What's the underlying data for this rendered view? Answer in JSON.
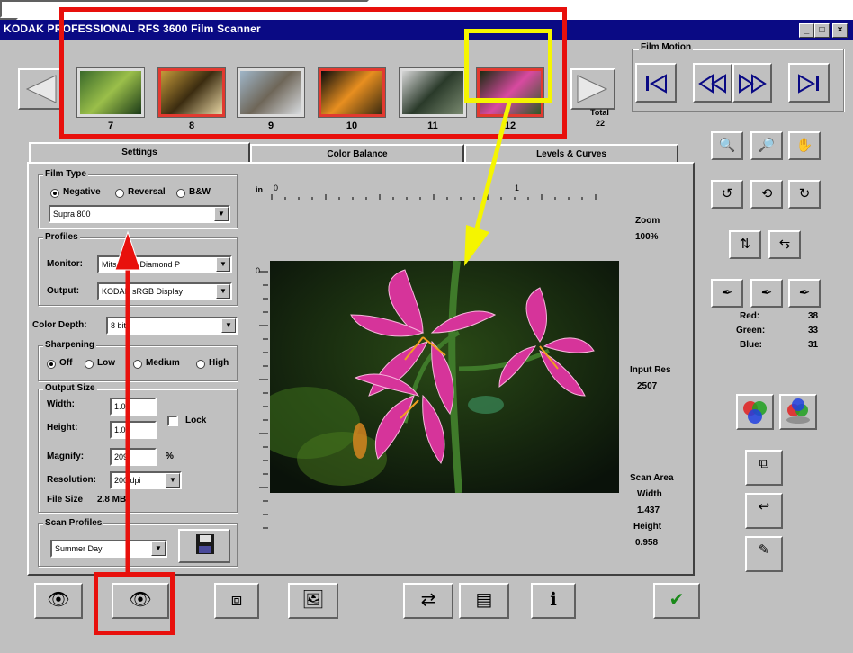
{
  "window": {
    "title": "KODAK PROFESSIONAL RFS 3600 Film Scanner",
    "minimize": "_",
    "maximize": "□",
    "close": "×"
  },
  "filmstrip": {
    "frames": [
      {
        "label": "7",
        "selected": false,
        "colors": [
          "#3a6a2a",
          "#9bbf4a",
          "#1b3a18"
        ]
      },
      {
        "label": "8",
        "selected": true,
        "colors": [
          "#c69a3a",
          "#3b2c10",
          "#e8d6a4"
        ]
      },
      {
        "label": "9",
        "selected": false,
        "colors": [
          "#9fb5c8",
          "#6e6658",
          "#d9dce0"
        ]
      },
      {
        "label": "10",
        "selected": true,
        "colors": [
          "#0b0b0b",
          "#e88f20",
          "#3a2a10"
        ]
      },
      {
        "label": "11",
        "selected": false,
        "colors": [
          "#d6d6d6",
          "#2a3a2a",
          "#7a8a70"
        ]
      },
      {
        "label": "12",
        "selected": true,
        "colors": [
          "#1a2a10",
          "#d84aa0",
          "#2f5a26"
        ]
      }
    ],
    "total_label": "Total",
    "total_value": "22"
  },
  "film_motion": {
    "label": "Film Motion"
  },
  "tabs": [
    {
      "label": "Settings",
      "active": true
    },
    {
      "label": "Color Balance",
      "active": false
    },
    {
      "label": "Levels & Curves",
      "active": false
    }
  ],
  "film_type": {
    "group_label": "Film Type",
    "options": [
      "Negative",
      "Reversal",
      "B&W"
    ],
    "selected": "Negative",
    "film": "Supra 800"
  },
  "profiles": {
    "group_label": "Profiles",
    "monitor_label": "Monitor:",
    "monitor_value": "Mitsubishi Diamond P",
    "output_label": "Output:",
    "output_value": "KODAK sRGB Display"
  },
  "color_depth": {
    "label": "Color Depth:",
    "value": "8 bit"
  },
  "sharpening": {
    "group_label": "Sharpening",
    "options": [
      "Off",
      "Low",
      "Medium",
      "High"
    ],
    "selected": "Off"
  },
  "output_size": {
    "group_label": "Output Size",
    "width_label": "Width:",
    "width_value": "1.00",
    "height_label": "Height:",
    "height_value": "1.00",
    "lock_label": "Lock",
    "magnify_label": "Magnify:",
    "magnify_value": "209",
    "magnify_unit": "%",
    "resolution_label": "Resolution:",
    "resolution_value": "200 dpi",
    "file_size_label": "File Size",
    "file_size_value": "2.8 MB"
  },
  "scan_profiles": {
    "group_label": "Scan Profiles",
    "value": "Summer Day"
  },
  "ruler": {
    "unit": "in",
    "h_zero": "0",
    "h_one": "1",
    "v_zero": "0"
  },
  "zoom": {
    "label": "Zoom",
    "value": "100%"
  },
  "input_res": {
    "label": "Input Res",
    "value": "2507"
  },
  "scan_area": {
    "label": "Scan Area",
    "width_label": "Width",
    "width_value": "1.437",
    "height_label": "Height",
    "height_value": "0.958"
  },
  "readout": {
    "red_label": "Red:",
    "red_value": "38",
    "green_label": "Green:",
    "green_value": "33",
    "blue_label": "Blue:",
    "blue_value": "31"
  },
  "preview": {
    "bg": "#0c1a08",
    "petal": "#d6349a",
    "stem": "#3f7a2a"
  },
  "annotation": {
    "highlight_color": "#e8100c",
    "arrow_color": "#f5f500"
  }
}
